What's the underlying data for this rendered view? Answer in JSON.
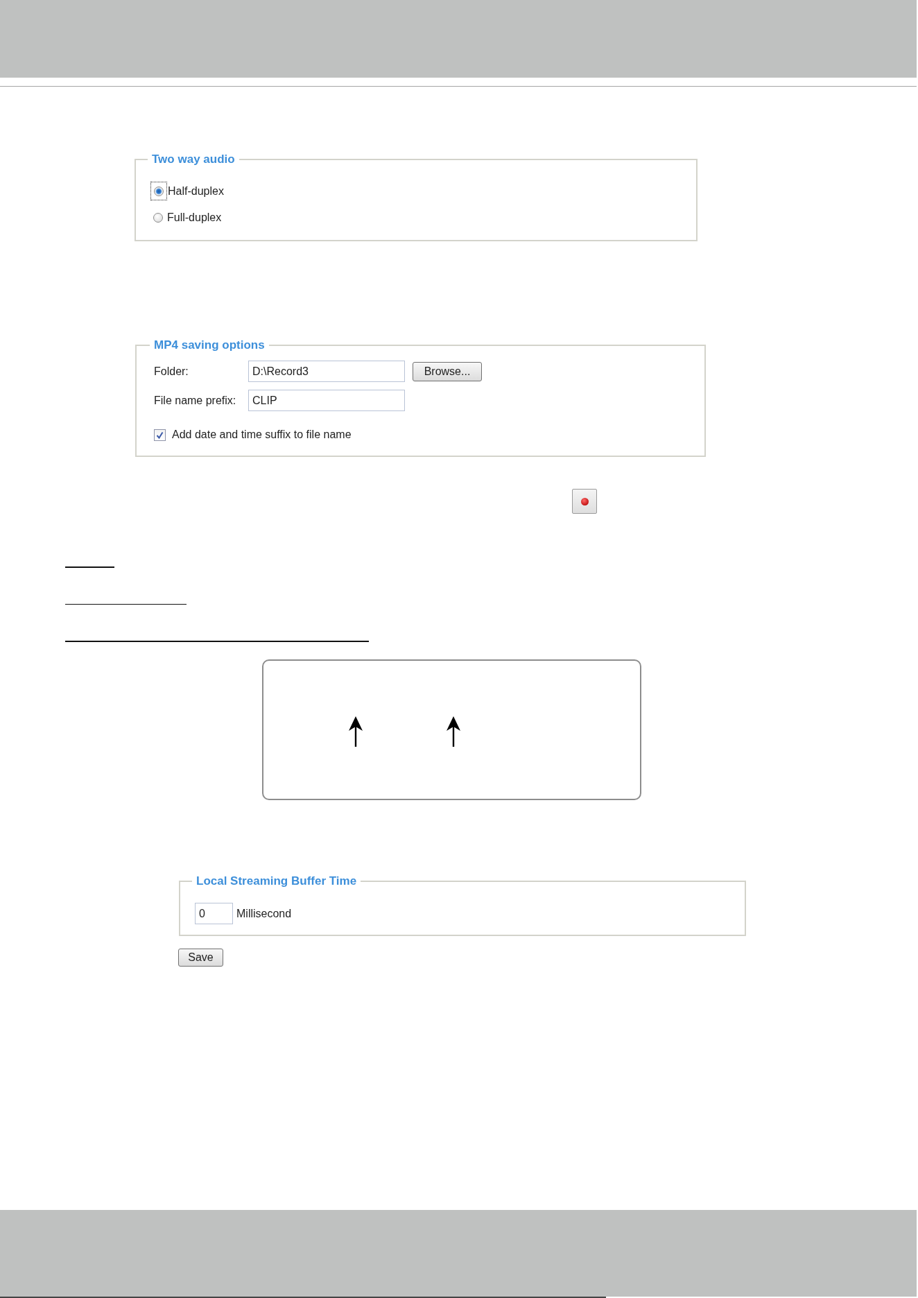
{
  "two_way_audio": {
    "title": "Two way audio",
    "options": [
      {
        "label": "Half-duplex",
        "selected": true,
        "focused": true
      },
      {
        "label": "Full-duplex",
        "selected": false,
        "focused": false
      }
    ]
  },
  "mp4_saving_options": {
    "title": "MP4 saving options",
    "folder": {
      "label": "Folder:",
      "value": "D:\\Record3"
    },
    "browse_button": "Browse...",
    "file_name_prefix": {
      "label": "File name prefix:",
      "value": "CLIP"
    },
    "date_time_suffix": {
      "label": "Add date and time suffix to file name",
      "checked": true
    }
  },
  "local_streaming_buffer_time": {
    "title": "Local Streaming Buffer Time",
    "value": "0",
    "unit": "Millisecond"
  },
  "save_button": "Save"
}
